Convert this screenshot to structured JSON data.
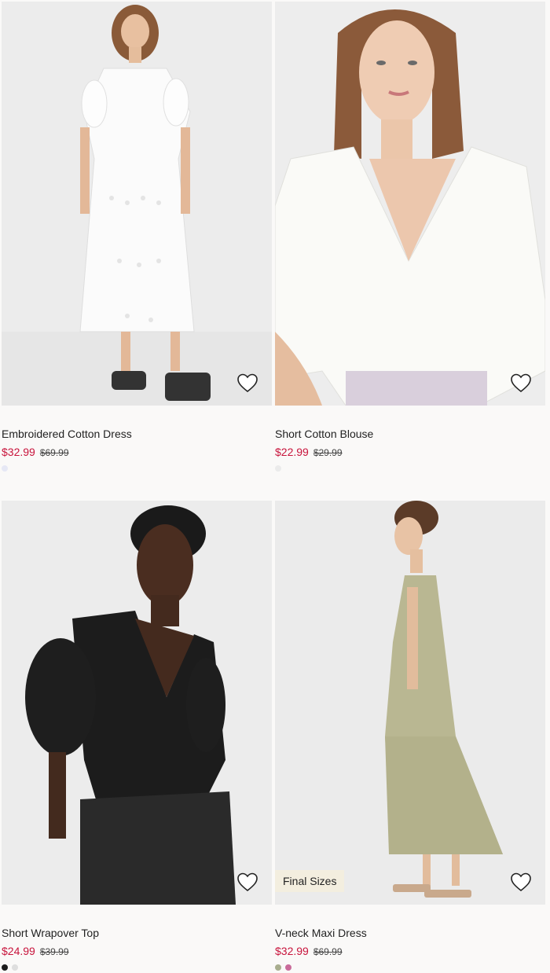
{
  "products": [
    {
      "title": "Embroidered Cotton Dress",
      "price": "$32.99",
      "original_price": "$69.99",
      "favorite_icon": "heart-outline-icon",
      "swatches": [
        "#e6e8f5"
      ]
    },
    {
      "title": "Short Cotton Blouse",
      "price": "$22.99",
      "original_price": "$29.99",
      "favorite_icon": "heart-outline-icon",
      "swatches": [
        "#ebebeb"
      ]
    },
    {
      "title": "Short Wrapover Top",
      "price": "$24.99",
      "original_price": "$39.99",
      "favorite_icon": "heart-outline-icon",
      "swatches": [
        "#1c1c1c",
        "#dedede"
      ]
    },
    {
      "title": "V-neck Maxi Dress",
      "price": "$32.99",
      "original_price": "$69.99",
      "badge": "Final Sizes",
      "favorite_icon": "heart-outline-icon",
      "swatches": [
        "#a8ad8e",
        "#c96b9a"
      ]
    }
  ],
  "colors": {
    "sale_price": "#c8143c",
    "background": "#faf9f8",
    "badge_bg": "#f3eedf"
  }
}
